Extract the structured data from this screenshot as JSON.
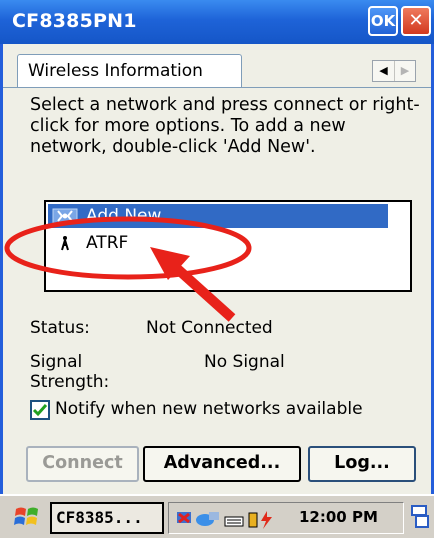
{
  "window": {
    "title": "CF8385PN1",
    "ok_label": "OK",
    "close_label": "✕"
  },
  "tab": {
    "label": "Wireless Information",
    "scroll_left": "◀",
    "scroll_right": "▶"
  },
  "instructions": "Select a network and press connect or right-click for more options.  To add a new network, double-click 'Add New'.",
  "networks": [
    {
      "label": "Add New...",
      "icon": "add-network-icon",
      "selected": true
    },
    {
      "label": "ATRF",
      "icon": "adhoc-network-icon",
      "selected": false
    }
  ],
  "status": {
    "label": "Status:",
    "value": "Not Connected"
  },
  "signal": {
    "label": "Signal Strength:",
    "value": "No Signal"
  },
  "notify": {
    "label": "Notify when new networks available",
    "checked": true
  },
  "buttons": {
    "connect": "Connect",
    "advanced": "Advanced...",
    "log": "Log..."
  },
  "taskbar": {
    "task_label": "CF8385...",
    "clock": "12:00 PM"
  },
  "colors": {
    "titlebar": "#1e63d8",
    "selection": "#316ac5",
    "annotation": "#e8221a",
    "dialog_bg": "#efefe6"
  }
}
